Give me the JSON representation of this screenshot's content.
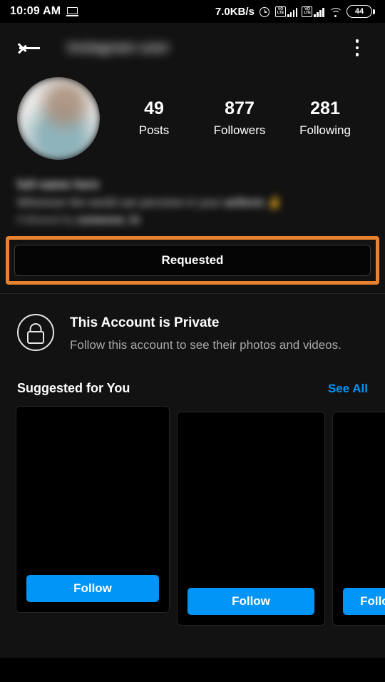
{
  "status_bar": {
    "time": "10:09 AM",
    "cast_icon": "laptop-icon",
    "network_speed": "7.0KB/s",
    "alarm_icon": "alarm-clock-icon",
    "volte_label": "VO\nLTE",
    "sim1": "volte-signal-icon",
    "sim2": "volte-signal-icon",
    "wifi_icon": "wifi-icon",
    "battery_level": "44"
  },
  "header": {
    "back_icon": "back-arrow-icon",
    "username_blurred": "instagram user",
    "menu_icon": "overflow-menu-icon"
  },
  "profile": {
    "avatar": "profile-avatar",
    "stats": [
      {
        "num": "49",
        "label": "Posts"
      },
      {
        "num": "877",
        "label": "Followers"
      },
      {
        "num": "281",
        "label": "Following"
      }
    ],
    "bio": {
      "name_blurred": "full name here",
      "desc_blurred": "Wherever the world can perceive in your",
      "desc_bold_blurred": "artform",
      "emoji": "✌",
      "followed_by_prefix": "Followed by",
      "followed_by_names_blurred": "someone_hi"
    }
  },
  "follow_action": {
    "button_label": "Requested",
    "highlight_color": "#e8822e"
  },
  "private_notice": {
    "lock_icon": "lock-icon",
    "title": "This Account is Private",
    "subtitle": "Follow this account to see their photos and videos."
  },
  "suggested": {
    "title": "Suggested for You",
    "see_all_label": "See All",
    "see_all_color": "#0095f6",
    "cards": [
      {
        "follow_label": "Follow"
      },
      {
        "follow_label": "Follow"
      },
      {
        "follow_label": "Follow"
      }
    ]
  }
}
